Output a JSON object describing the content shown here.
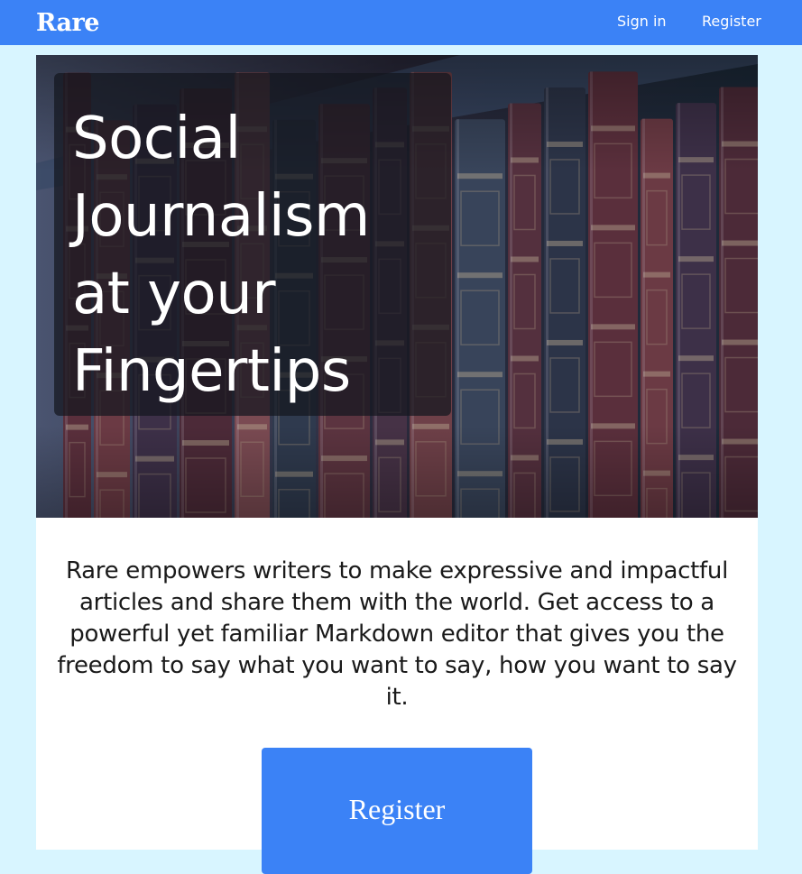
{
  "navbar": {
    "brand": "Rare",
    "links": [
      {
        "label": "Sign in"
      },
      {
        "label": "Register"
      }
    ]
  },
  "hero": {
    "title": "Social Journalism at your Fingertips",
    "image_description_icon": "bookshelf-image"
  },
  "main": {
    "tagline": "Rare empowers writers to make expressive and impactful articles and share them with the world. Get access to a powerful yet familiar Markdown editor that gives you the freedom to say what you want to say, how you want to say it.",
    "cta_label": "Register"
  },
  "colors": {
    "navbar": "#3b82f6",
    "page_background": "#d8f5ff",
    "button": "#3b82f6",
    "text": "#1a1a1a"
  }
}
